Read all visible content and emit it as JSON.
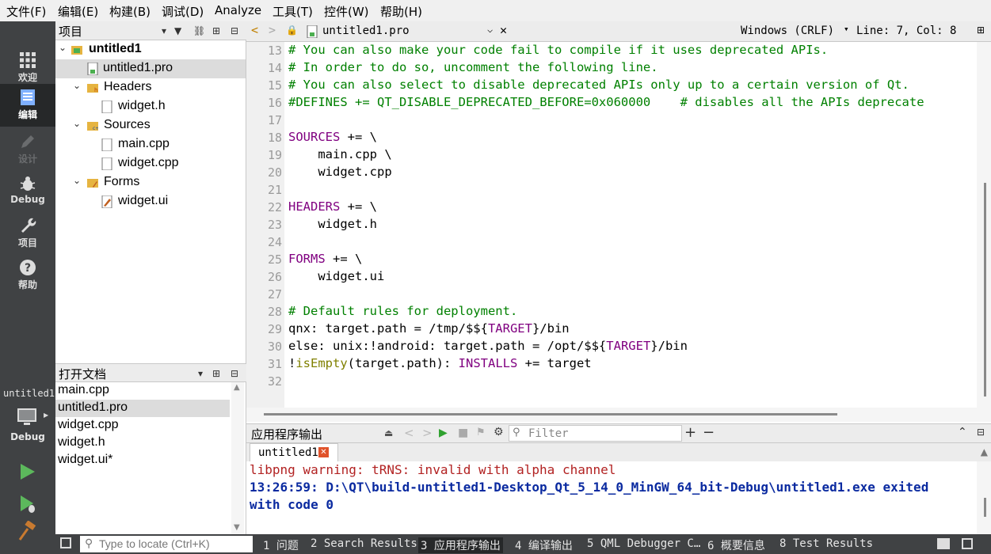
{
  "menu": [
    "文件(F)",
    "编辑(E)",
    "构建(B)",
    "调试(D)",
    "Analyze",
    "工具(T)",
    "控件(W)",
    "帮助(H)"
  ],
  "modes": {
    "welcome": "欢迎",
    "edit": "编辑",
    "design": "设计",
    "debug": "Debug",
    "projects": "项目",
    "help": "帮助"
  },
  "kit": {
    "project": "untitled1",
    "config": "Debug"
  },
  "project_pane": {
    "title": "项目",
    "tree": {
      "root": "untitled1",
      "pro_file": "untitled1.pro",
      "headers": "Headers",
      "header_file": "widget.h",
      "sources": "Sources",
      "source_main": "main.cpp",
      "source_widget": "widget.cpp",
      "forms": "Forms",
      "form_file": "widget.ui"
    }
  },
  "open_docs": {
    "title": "打开文档",
    "items": [
      "main.cpp",
      "untitled1.pro",
      "widget.cpp",
      "widget.h",
      "widget.ui*"
    ]
  },
  "editor": {
    "file_name": "untitled1.pro",
    "line_ending": "Windows (CRLF)",
    "cursor": "Line: 7, Col: 8",
    "line_numbers": [
      "13",
      "14",
      "15",
      "16",
      "17",
      "18",
      "19",
      "20",
      "21",
      "22",
      "23",
      "24",
      "25",
      "26",
      "27",
      "28",
      "29",
      "30",
      "31",
      "32"
    ],
    "lines": {
      "l13": "# You can also make your code fail to compile if it uses deprecated APIs.",
      "l14": "# In order to do so, uncomment the following line.",
      "l15": "# You can also select to disable deprecated APIs only up to a certain version of Qt.",
      "l16a": "#DEFINES += QT_DISABLE_DEPRECATED_BEFORE=0x060000",
      "l16b": "    # disables all the APIs deprecate",
      "l18a": "SOURCES",
      "l18b": " += \\",
      "l19": "    main.cpp \\",
      "l20": "    widget.cpp",
      "l22a": "HEADERS",
      "l22b": " += \\",
      "l23": "    widget.h",
      "l25a": "FORMS",
      "l25b": " += \\",
      "l26": "    widget.ui",
      "l28": "# Default rules for deployment.",
      "l29a": "qnx: target.path = /tmp/$${",
      "l29b": "TARGET",
      "l29c": "}/bin",
      "l30a": "else: unix:!android: target.path = /opt/$${",
      "l30b": "TARGET",
      "l30c": "}/bin",
      "l31a": "!",
      "l31b": "isEmpty",
      "l31c": "(target.path): ",
      "l31d": "INSTALLS",
      "l31e": " += target"
    }
  },
  "output_pane": {
    "title": "应用程序输出",
    "filter_placeholder": "Filter",
    "tab": "untitled1",
    "warning": "libpng warning: tRNS: invalid with alpha channel",
    "exit_line1": "13:26:59: D:\\QT\\build-untitled1-Desktop_Qt_5_14_0_MinGW_64_bit-Debug\\untitled1.exe exited",
    "exit_line2": "with code 0"
  },
  "statusbar": {
    "locator_placeholder": "Type to locate (Ctrl+K)",
    "tabs": [
      "1 问题",
      "2 Search Results",
      "3 应用程序输出",
      "4 编译输出",
      "5 QML Debugger C…",
      "6 概要信息",
      "8 Test Results"
    ]
  },
  "colors": {
    "comment": "#008000",
    "keyword": "#800080",
    "function": "#808000",
    "error_text": "#b22222",
    "info_text": "#0a2aa0",
    "modebar": "#404244"
  }
}
